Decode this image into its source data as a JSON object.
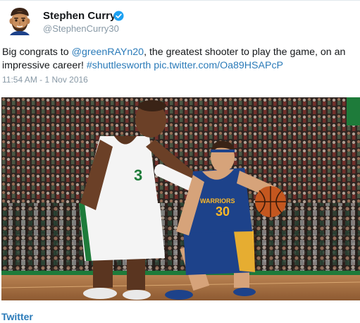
{
  "user": {
    "display_name": "Stephen Curry",
    "screen_name": "@StephenCurry30",
    "verified": true
  },
  "tweet": {
    "text_before_mention": "Big congrats to ",
    "mention": "@greenRAYn20",
    "text_after_mention": ", the greatest shooter to play the game, on an impressive career! ",
    "hashtag": "#shuttlesworth",
    "space": " ",
    "pic_link": "pic.twitter.com/Oa89HSAPcP",
    "timestamp": "11:54 AM - 1 Nov 2016"
  },
  "photo": {
    "jersey_number": "30",
    "jersey_text": "WARRIORS"
  },
  "footer": {
    "source_label": "Twitter"
  },
  "colors": {
    "link": "#2b7bb9",
    "verified_badge": "#1da1f2",
    "celtics_green": "#1e7b3a",
    "warriors_blue": "#1d428a",
    "warriors_gold": "#fdb927"
  }
}
